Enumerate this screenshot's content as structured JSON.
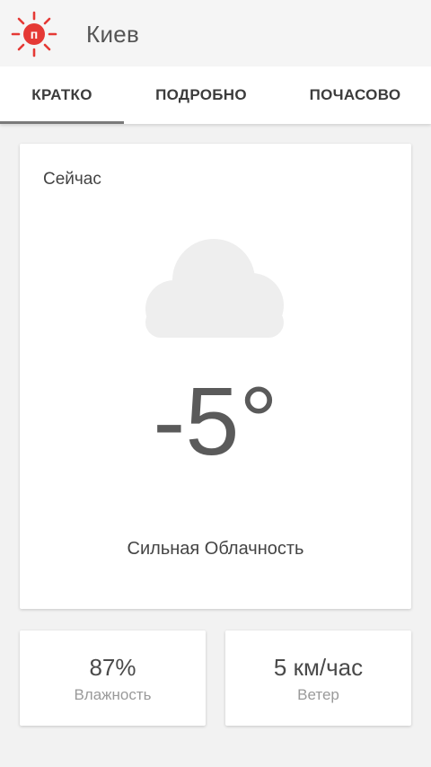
{
  "app": {
    "logo_letter": "п",
    "logo_color": "#e53935",
    "city": "Киев"
  },
  "tabs": [
    {
      "label": "КРАТКО",
      "active": true
    },
    {
      "label": "ПОДРОБНО",
      "active": false
    },
    {
      "label": "ПОЧАСОВО",
      "active": false
    }
  ],
  "now": {
    "label": "Сейчас",
    "icon": "cloud-icon",
    "temperature": "-5°",
    "condition": "Сильная Облачность"
  },
  "stats": {
    "humidity": {
      "value": "87%",
      "label": "Влажность"
    },
    "wind": {
      "value": "5 км/час",
      "label": "Ветер"
    }
  }
}
